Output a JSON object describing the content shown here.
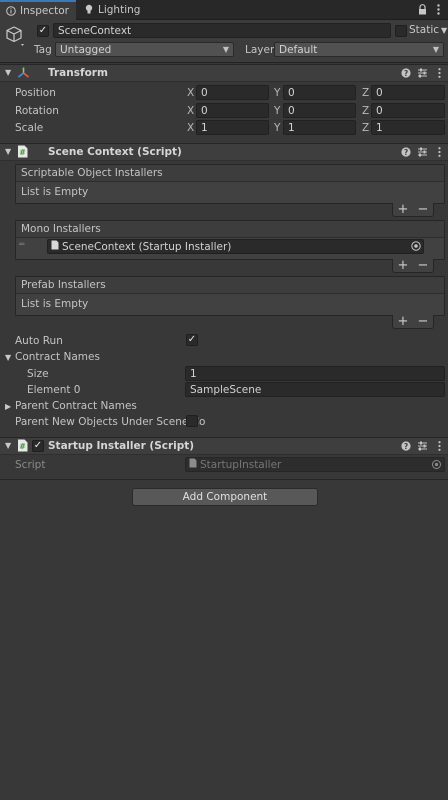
{
  "tabs": [
    {
      "label": "Inspector",
      "icon": "info-icon",
      "active": true
    },
    {
      "label": "Lighting",
      "icon": "lightbulb-icon",
      "active": false
    }
  ],
  "header": {
    "object_name": "SceneContext",
    "active": true,
    "static_label": "Static",
    "tag_label": "Tag",
    "tag_value": "Untagged",
    "layer_label": "Layer",
    "layer_value": "Default"
  },
  "transform": {
    "title": "Transform",
    "rows": [
      {
        "label": "Position",
        "x": "0",
        "y": "0",
        "z": "0"
      },
      {
        "label": "Rotation",
        "x": "0",
        "y": "0",
        "z": "0"
      },
      {
        "label": "Scale",
        "x": "1",
        "y": "1",
        "z": "1"
      }
    ],
    "axes": {
      "x": "X",
      "y": "Y",
      "z": "Z"
    }
  },
  "scene_context": {
    "title": "Scene Context (Script)",
    "scriptable_title": "Scriptable Object Installers",
    "scriptable_empty": "List is Empty",
    "mono_title": "Mono Installers",
    "mono_item": "SceneContext (Startup Installer)",
    "prefab_title": "Prefab Installers",
    "prefab_empty": "List is Empty",
    "add_symbol": "+",
    "remove_symbol": "−",
    "auto_run_label": "Auto Run",
    "auto_run": true,
    "contract_names_label": "Contract Names",
    "size_label": "Size",
    "size_value": "1",
    "element0_label": "Element 0",
    "element0_value": "SampleScene",
    "parent_contract_label": "Parent Contract Names",
    "parent_new_objects_label": "Parent New Objects Under Scene Co",
    "parent_new_objects": false
  },
  "startup_installer": {
    "title": "Startup Installer (Script)",
    "enabled": true,
    "script_label": "Script",
    "script_value": "StartupInstaller"
  },
  "add_component_label": "Add Component",
  "colors": {
    "background": "#383838",
    "accent_tab": "#3a79bb",
    "field": "#2a2a2a"
  }
}
